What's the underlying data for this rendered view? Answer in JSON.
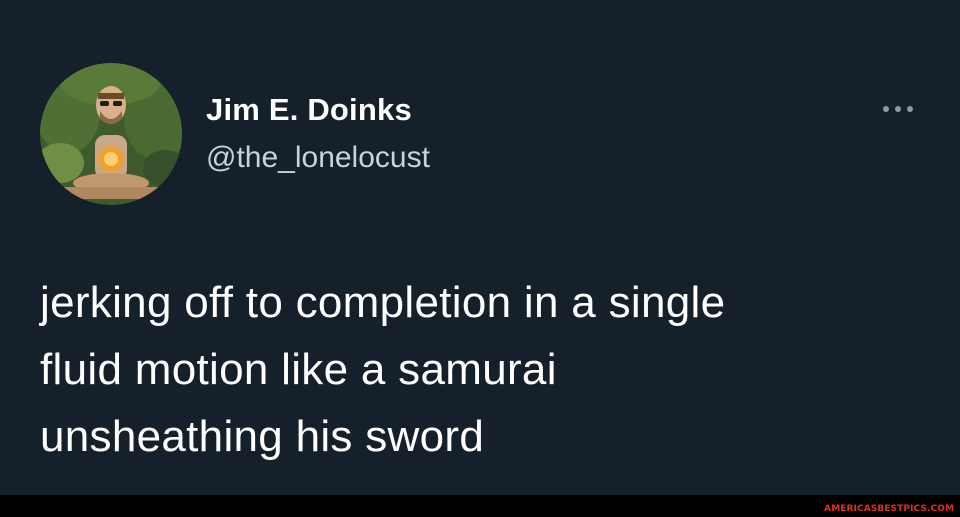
{
  "tweet": {
    "author": {
      "display_name": "Jim E. Doinks",
      "handle": "@the_lonelocust",
      "avatar_icon": "avatar-meditating-figure"
    },
    "more_icon": "more-options-icon",
    "text_lines": [
      "jerking off to completion in a single",
      "fluid motion like a samurai",
      "unsheathing his sword"
    ]
  },
  "watermark": "AMERICASBESTPICS.COM",
  "colors": {
    "background": "#15202b",
    "text": "#ffffff",
    "handle": "#c9d1d9",
    "more_icon": "#8b98a5",
    "watermark": "#e0301e"
  }
}
